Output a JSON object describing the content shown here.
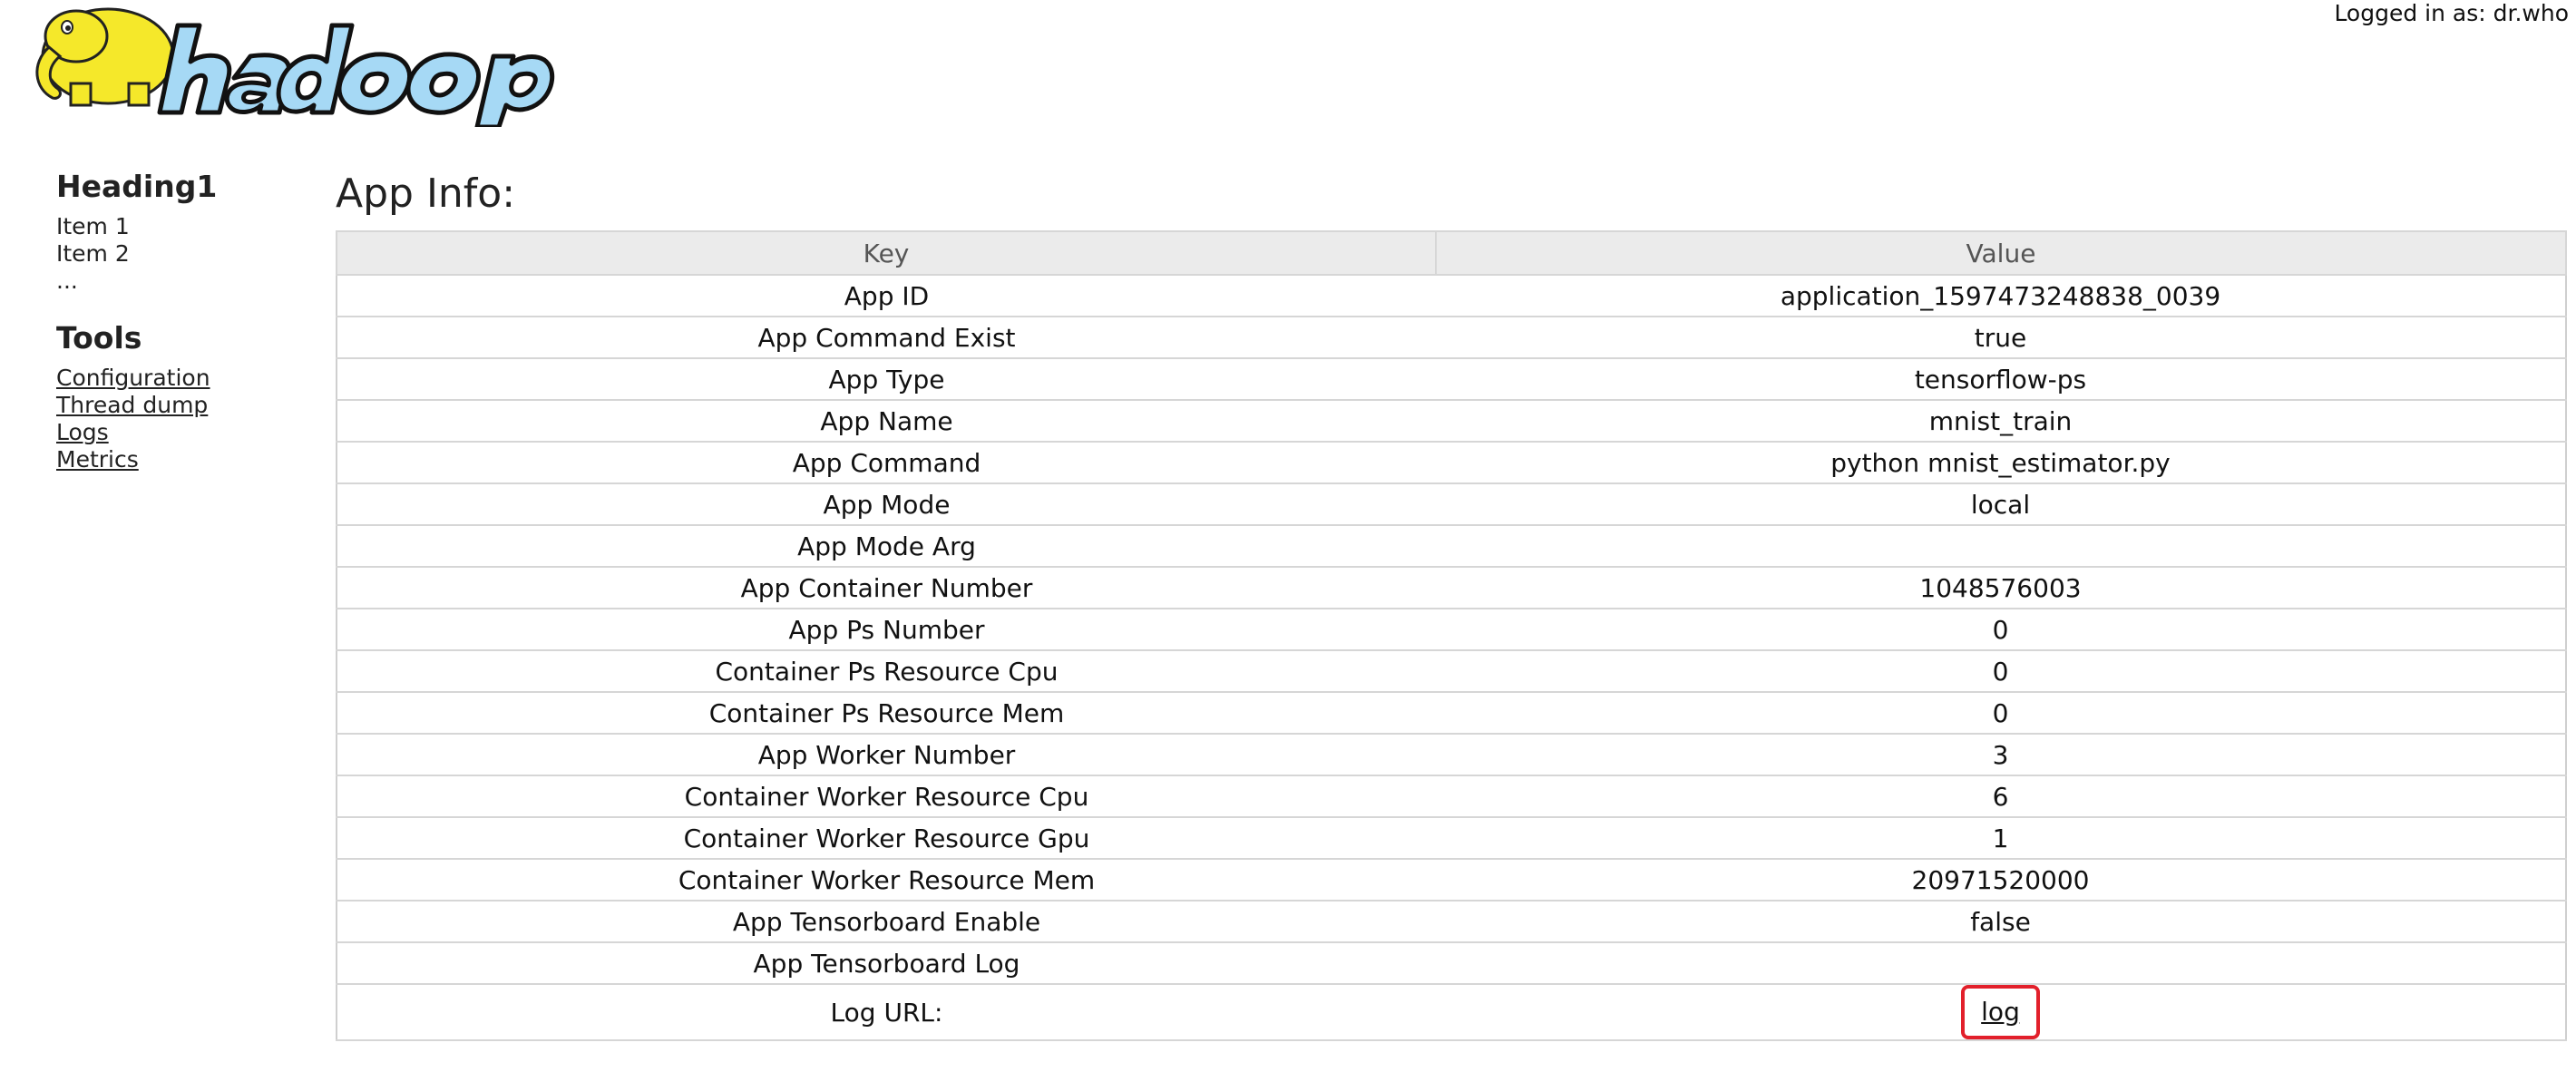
{
  "header": {
    "logo_alt": "hadoop",
    "logged_in_text": "Logged in as: dr.who"
  },
  "sidebar": {
    "heading1": "Heading1",
    "items": [
      "Item 1",
      "Item 2",
      "..."
    ],
    "tools_heading": "Tools",
    "tools": [
      "Configuration",
      "Thread dump",
      "Logs",
      "Metrics"
    ]
  },
  "main": {
    "title": "App Info:",
    "columns": {
      "key": "Key",
      "value": "Value"
    },
    "rows": [
      {
        "key": "App ID",
        "value": "application_1597473248838_0039"
      },
      {
        "key": "App Command Exist",
        "value": "true"
      },
      {
        "key": "App Type",
        "value": "tensorflow-ps"
      },
      {
        "key": "App Name",
        "value": "mnist_train"
      },
      {
        "key": "App Command",
        "value": "python mnist_estimator.py"
      },
      {
        "key": "App Mode",
        "value": "local"
      },
      {
        "key": "App Mode Arg",
        "value": ""
      },
      {
        "key": "App Container Number",
        "value": "1048576003"
      },
      {
        "key": "App Ps Number",
        "value": "0"
      },
      {
        "key": "Container Ps Resource Cpu",
        "value": "0"
      },
      {
        "key": "Container Ps Resource Mem",
        "value": "0"
      },
      {
        "key": "App Worker Number",
        "value": "3"
      },
      {
        "key": "Container Worker Resource Cpu",
        "value": "6"
      },
      {
        "key": "Container Worker Resource Gpu",
        "value": "1"
      },
      {
        "key": "Container Worker Resource Mem",
        "value": "20971520000"
      },
      {
        "key": "App Tensorboard Enable",
        "value": "false"
      },
      {
        "key": "App Tensorboard Log",
        "value": ""
      },
      {
        "key": "Log URL:",
        "value": "log"
      }
    ]
  },
  "colors": {
    "logo_yellow": "#f5e82a",
    "logo_blue": "#a6d9f5",
    "highlight_red": "#e2202b",
    "header_bg": "#ebebeb"
  }
}
